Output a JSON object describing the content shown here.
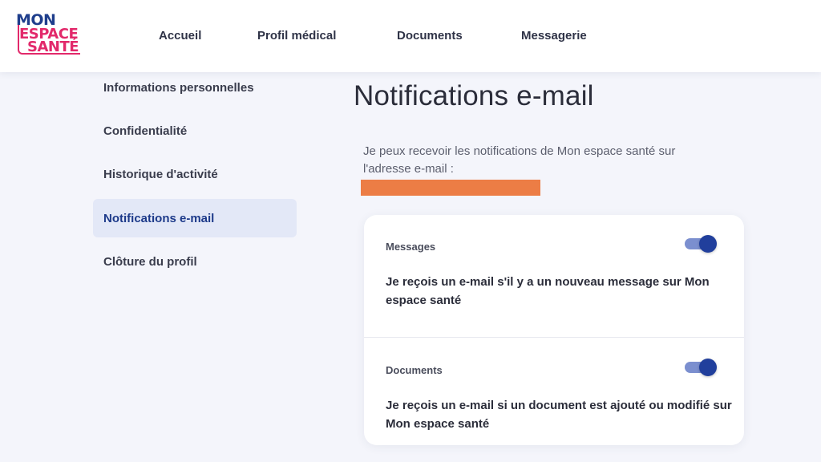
{
  "logo": {
    "line1": "MON",
    "line2": "ESPACE",
    "line3": "SANTÉ",
    "colors": {
      "blue": "#1f3e8c",
      "pink": "#e2296b"
    }
  },
  "nav": {
    "items": [
      {
        "label": "Accueil"
      },
      {
        "label": "Profil médical"
      },
      {
        "label": "Documents"
      },
      {
        "label": "Messagerie"
      }
    ]
  },
  "sidebar": {
    "items": [
      {
        "label": "Informations personnelles",
        "active": false
      },
      {
        "label": "Confidentialité",
        "active": false
      },
      {
        "label": "Historique d'activité",
        "active": false
      },
      {
        "label": "Notifications e-mail",
        "active": true
      },
      {
        "label": "Clôture du profil",
        "active": false
      }
    ]
  },
  "main": {
    "title": "Notifications e-mail",
    "intro": "Je peux recevoir les notifications de Mon espace santé sur l'adresse e-mail :",
    "email_redacted_color": "#ec7d45",
    "settings": [
      {
        "label": "Messages",
        "description": "Je reçois un e-mail s'il y a un nouveau message sur Mon espace santé",
        "enabled": true
      },
      {
        "label": "Documents",
        "description": "Je reçois un e-mail si un document est ajouté ou modifié sur Mon espace santé",
        "enabled": true
      }
    ]
  },
  "colors": {
    "accent": "#213f9c",
    "active_bg": "#e3e8f7",
    "background": "#f4f5fb"
  }
}
